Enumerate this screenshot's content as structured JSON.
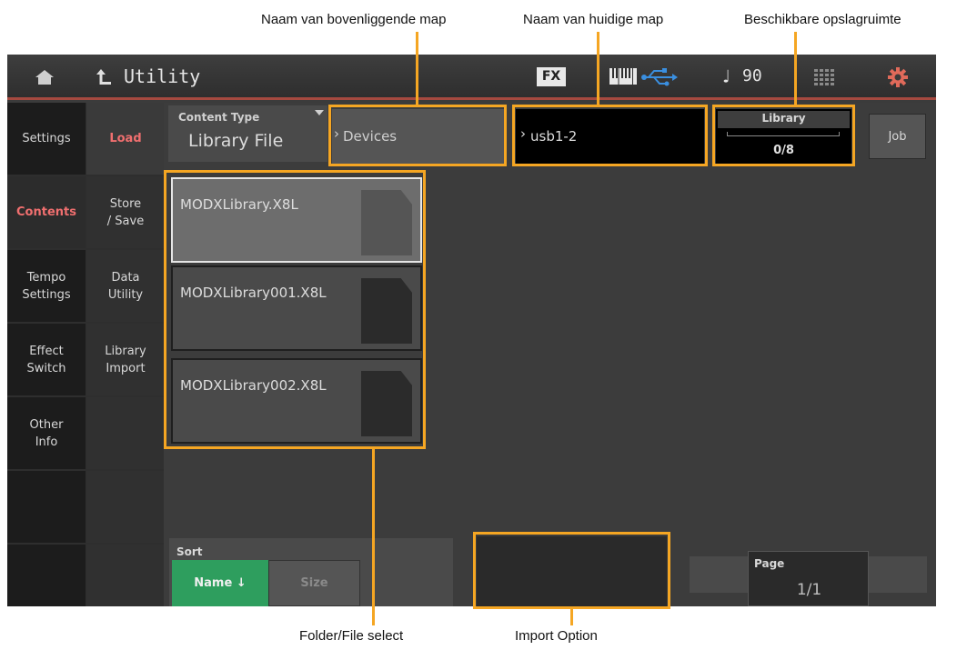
{
  "annotations": {
    "parent_folder": "Naam van bovenliggende map",
    "current_folder": "Naam van huidige map",
    "available_storage": "Beschikbare opslagruimte",
    "folder_file_select": "Folder/File select",
    "import_option": "Import Option"
  },
  "header": {
    "title": "Utility",
    "fx_label": "FX",
    "tempo": "90",
    "tempo_symbol": "♩"
  },
  "nav_left": [
    "Settings",
    "Contents",
    "Tempo\nSettings",
    "Effect\nSwitch",
    "Other\nInfo"
  ],
  "nav_sub": [
    "Load",
    "Store\n/ Save",
    "Data\nUtility",
    "Library\nImport"
  ],
  "content_type": {
    "label": "Content Type",
    "value": "Library File"
  },
  "path": {
    "parent": "Devices",
    "current": "usb1-2"
  },
  "storage": {
    "label": "Library",
    "value": "0/8",
    "fill": 0.0
  },
  "job_label": "Job",
  "files": [
    "MODXLibrary.X8L",
    "MODXLibrary001.X8L",
    "MODXLibrary002.X8L"
  ],
  "sort": {
    "label": "Sort",
    "name_button": "Name ↓",
    "size_button": "Size"
  },
  "page": {
    "label": "Page",
    "value": "1/1"
  },
  "colors": {
    "accent": "#f5a623",
    "active_text": "#f06f6f",
    "sort_active": "#2e9e5e",
    "header_line": "#a5493f"
  }
}
